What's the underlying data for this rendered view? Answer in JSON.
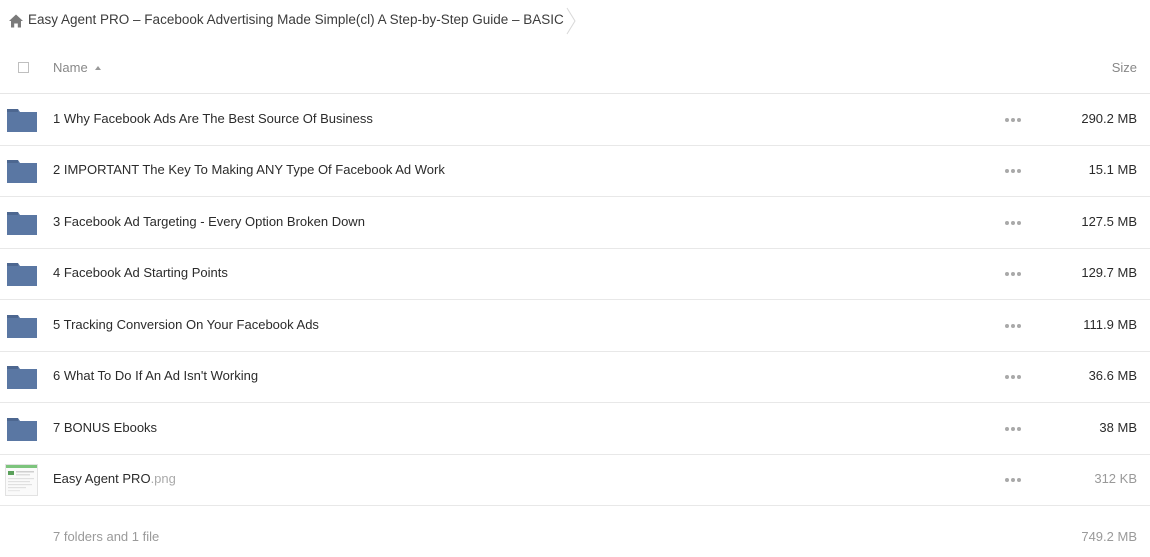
{
  "breadcrumb": {
    "icon": "home-icon",
    "label": "Easy Agent PRO – Facebook Advertising Made Simple(cl) A Step-by-Step Guide – BASIC"
  },
  "header": {
    "name_label": "Name",
    "size_label": "Size",
    "sort": "ascending"
  },
  "colors": {
    "folder": "#5a77a3",
    "folder_tab": "#4d6790"
  },
  "rows": [
    {
      "type": "folder",
      "name": "1 Why Facebook Ads Are The Best Source Of Business",
      "ext": "",
      "size": "290.2 MB"
    },
    {
      "type": "folder",
      "name": "2 IMPORTANT The Key To Making ANY Type Of Facebook Ad Work",
      "ext": "",
      "size": "15.1 MB"
    },
    {
      "type": "folder",
      "name": "3 Facebook Ad Targeting - Every Option Broken Down",
      "ext": "",
      "size": "127.5 MB"
    },
    {
      "type": "folder",
      "name": "4 Facebook Ad Starting Points",
      "ext": "",
      "size": "129.7 MB"
    },
    {
      "type": "folder",
      "name": "5 Tracking Conversion On Your Facebook Ads",
      "ext": "",
      "size": "111.9 MB"
    },
    {
      "type": "folder",
      "name": "6 What To Do If An Ad Isn't Working",
      "ext": "",
      "size": "36.6 MB"
    },
    {
      "type": "folder",
      "name": "7 BONUS Ebooks",
      "ext": "",
      "size": "38 MB"
    },
    {
      "type": "file",
      "name": "Easy Agent PRO",
      "ext": ".png",
      "size": "312 KB"
    }
  ],
  "footer": {
    "summary": "7 folders and 1 file",
    "total_size": "749.2 MB"
  }
}
